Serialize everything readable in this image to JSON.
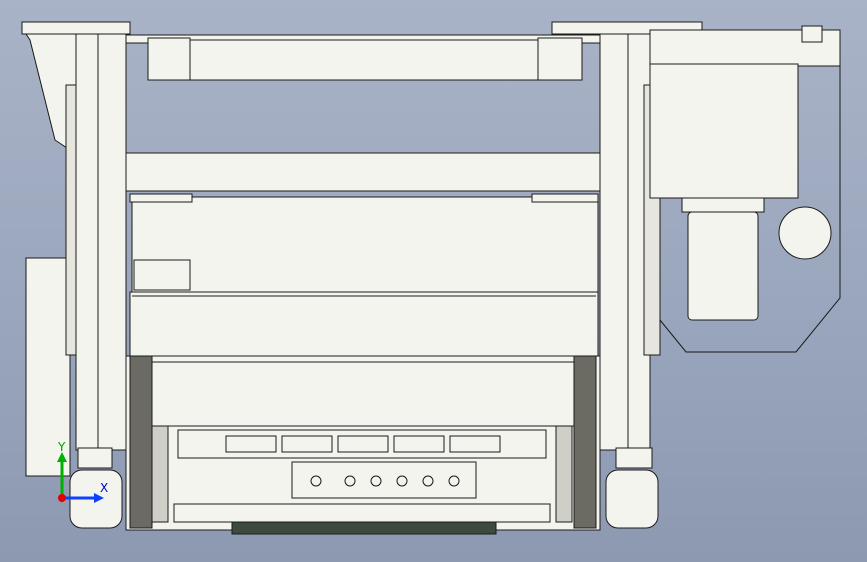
{
  "view": {
    "background_top": "#a9b3c7",
    "background_bottom": "#8d99b1",
    "part_fill": "#f4f4ee",
    "edge_color": "#1a1a1a"
  },
  "axis_triad": {
    "y_label": "Y",
    "x_label": "X",
    "y_color": "#00b000",
    "x_color": "#1040ff",
    "origin_color": "#e00000"
  }
}
